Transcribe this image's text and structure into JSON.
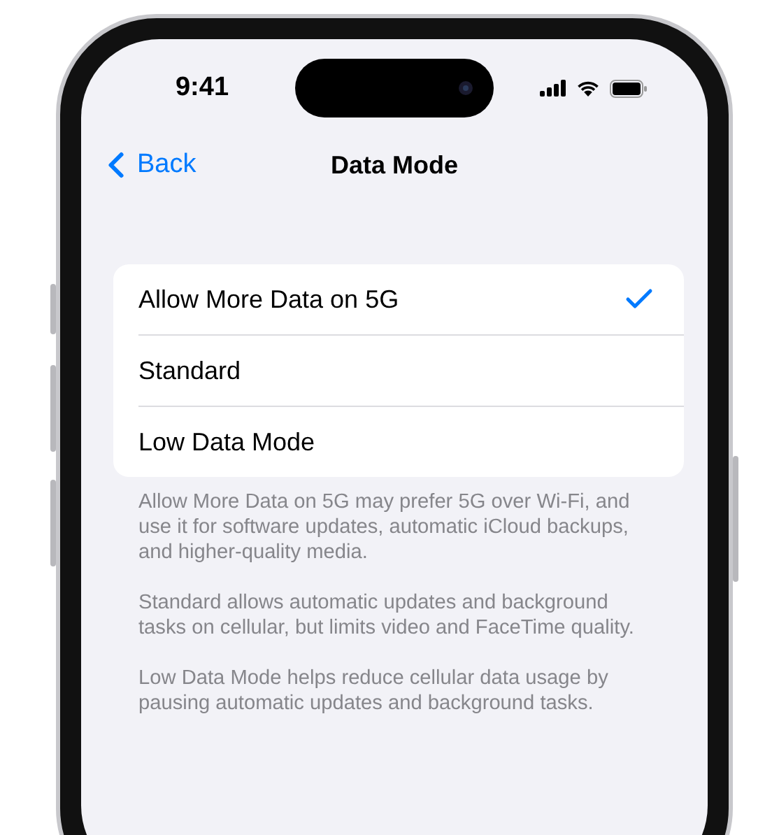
{
  "status_bar": {
    "time": "9:41"
  },
  "nav": {
    "back": "Back",
    "title": "Data Mode"
  },
  "options": [
    {
      "label": "Allow More Data on 5G",
      "selected": true
    },
    {
      "label": "Standard",
      "selected": false
    },
    {
      "label": "Low Data Mode",
      "selected": false
    }
  ],
  "footnotes": [
    "Allow More Data on 5G may prefer 5G over Wi-Fi, and use it for software updates, automatic iCloud backups, and higher-quality media.",
    "Standard allows automatic updates and background tasks on cellular, but limits video and FaceTime quality.",
    "Low Data Mode helps reduce cellular data usage by pausing automatic updates and background tasks."
  ]
}
